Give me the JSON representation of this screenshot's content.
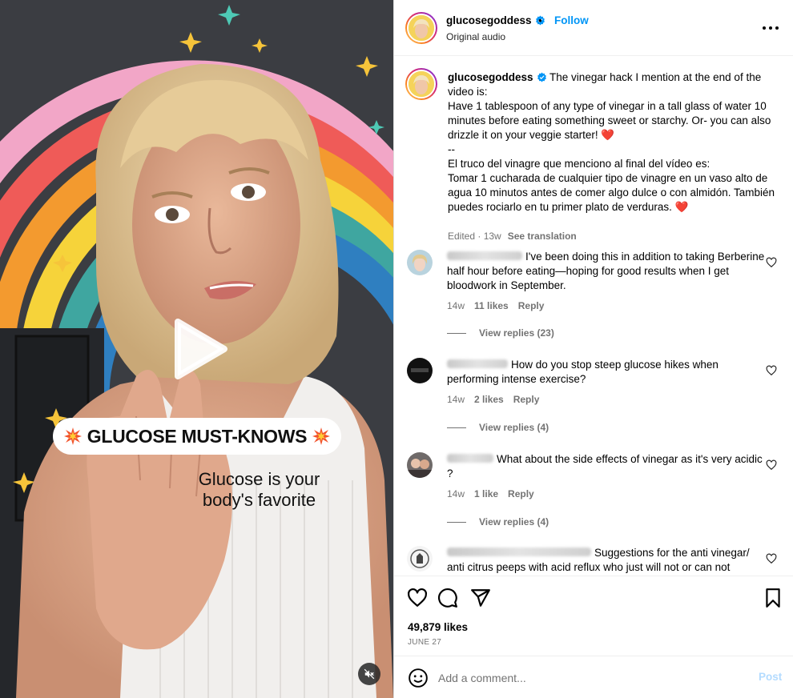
{
  "post": {
    "username": "glucosegoddess",
    "follow_label": "Follow",
    "separator": "•",
    "audio": "Original audio",
    "more_icon": "more-horizontal-icon"
  },
  "video": {
    "caption": "GLUCOSE MUST-KNOWS",
    "subtitle_line1": "Glucose is your",
    "subtitle_line2": "body's favorite",
    "play_icon": "play-icon",
    "mute_icon": "speaker-muted-icon"
  },
  "caption": {
    "text": "The vinegar hack I mention at the end of the video is:\nHave 1 tablespoon of any type of vinegar in a tall glass of water 10 minutes before eating something sweet or starchy. Or- you can also drizzle it on your veggie starter! ❤️\n--\nEl truco del vinagre que menciono al final del vídeo es:\nTomar 1 cucharada de cualquier tipo de vinagre en un vaso alto de agua 10 minutos antes de comer algo dulce o con almidón. También puedes rociarlo en tu primer plato de verduras. ❤️",
    "edited": "Edited · 13w",
    "see_translation": "See translation"
  },
  "comments": [
    {
      "text": "I've been doing this in addition to taking Berberine half hour before eating—hoping for good results when I get bloodwork in September.",
      "time": "14w",
      "likes": "11 likes",
      "reply": "Reply",
      "view_replies": "View replies (23)"
    },
    {
      "text": "How do you stop steep glucose hikes when performing intense exercise?",
      "time": "14w",
      "likes": "2 likes",
      "reply": "Reply",
      "view_replies": "View replies (4)"
    },
    {
      "text": "What about the side effects of vinegar as it's very acidic ?",
      "time": "14w",
      "likes": "1 like",
      "reply": "Reply",
      "view_replies": "View replies (4)"
    },
    {
      "text": "Suggestions for the anti vinegar/ anti citrus peeps with acid reflux who just will not or can not"
    }
  ],
  "actions": {
    "likes": "49,879 likes",
    "date": "JUNE 27"
  },
  "comment_box": {
    "placeholder": "Add a comment...",
    "post_label": "Post"
  },
  "colors": {
    "accent": "#0095f6",
    "muted_text": "#737373",
    "post_disabled": "#b3dbff",
    "heart": "#ed4956"
  }
}
